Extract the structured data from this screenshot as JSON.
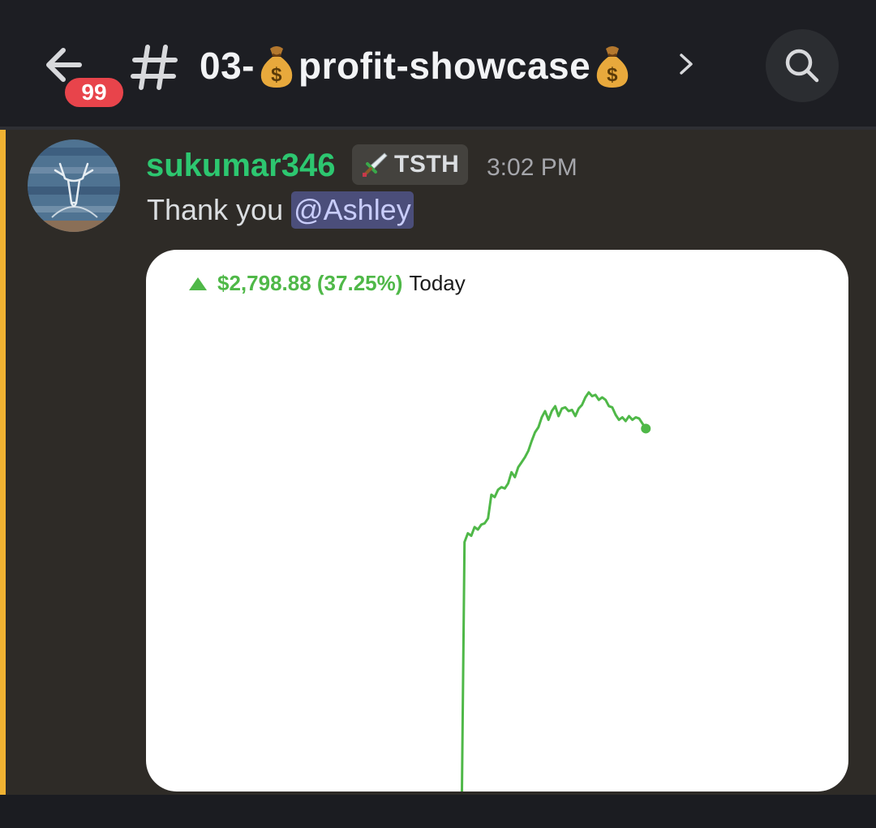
{
  "header": {
    "unread_badge": "99",
    "channel_prefix": "03-",
    "channel_middle": "profit-showcase",
    "channel_icon": "moneybag-emoji",
    "back_icon": "arrow-left-icon",
    "search_icon": "search-icon"
  },
  "message": {
    "username": "sukumar346",
    "username_color": "#2dc770",
    "role_icon": "sword-icon",
    "role_tag": "TSTH",
    "timestamp": "3:02 PM",
    "text": "Thank you",
    "mention": "@Ashley"
  },
  "attachment": {
    "change_amount": "$2,798.88 (37.25%)",
    "period": "Today",
    "accent_color": "#4fb848",
    "chart_data": {
      "type": "line",
      "title": "",
      "series": [
        {
          "values": [
            0,
            0,
            0,
            0,
            0,
            0,
            0,
            0,
            0,
            0,
            0,
            0,
            2000,
            2070,
            2050,
            2120,
            2100,
            2140,
            2150,
            2190,
            2380,
            2360,
            2420,
            2440,
            2430,
            2470,
            2560,
            2520,
            2600,
            2640,
            2680,
            2730,
            2810,
            2880,
            2920,
            3000,
            3050,
            2980,
            3050,
            3090,
            3010,
            3070,
            3080,
            3050,
            3060,
            3010,
            3070,
            3100,
            3160,
            3200,
            3170,
            3180,
            3140,
            3160,
            3140,
            3090,
            3080,
            3020,
            2980,
            3000,
            2970,
            3010,
            2980,
            3000,
            2990,
            2950,
            2910
          ]
        }
      ]
    }
  }
}
